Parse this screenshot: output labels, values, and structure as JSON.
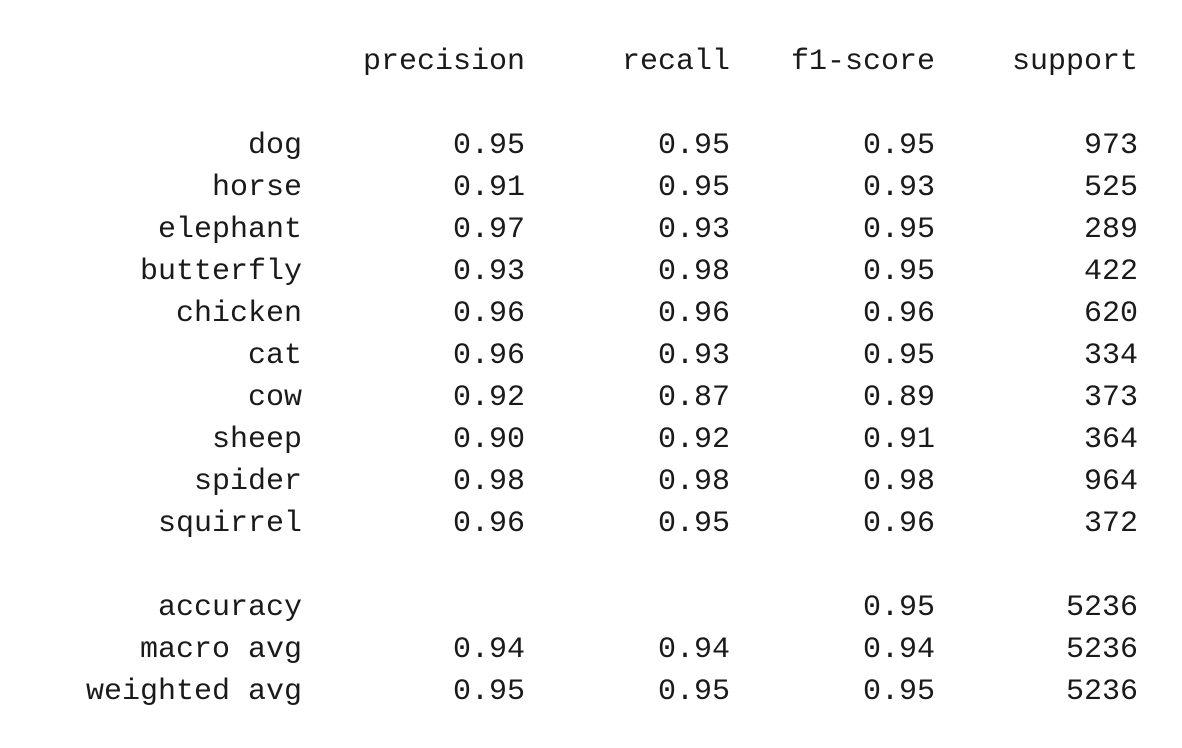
{
  "report": {
    "headers": {
      "precision": "precision",
      "recall": "recall",
      "f1": "f1-score",
      "support": "support"
    },
    "classes": [
      {
        "label": "dog",
        "precision": "0.95",
        "recall": "0.95",
        "f1": "0.95",
        "support": "973"
      },
      {
        "label": "horse",
        "precision": "0.91",
        "recall": "0.95",
        "f1": "0.93",
        "support": "525"
      },
      {
        "label": "elephant",
        "precision": "0.97",
        "recall": "0.93",
        "f1": "0.95",
        "support": "289"
      },
      {
        "label": "butterfly",
        "precision": "0.93",
        "recall": "0.98",
        "f1": "0.95",
        "support": "422"
      },
      {
        "label": "chicken",
        "precision": "0.96",
        "recall": "0.96",
        "f1": "0.96",
        "support": "620"
      },
      {
        "label": "cat",
        "precision": "0.96",
        "recall": "0.93",
        "f1": "0.95",
        "support": "334"
      },
      {
        "label": "cow",
        "precision": "0.92",
        "recall": "0.87",
        "f1": "0.89",
        "support": "373"
      },
      {
        "label": "sheep",
        "precision": "0.90",
        "recall": "0.92",
        "f1": "0.91",
        "support": "364"
      },
      {
        "label": "spider",
        "precision": "0.98",
        "recall": "0.98",
        "f1": "0.98",
        "support": "964"
      },
      {
        "label": "squirrel",
        "precision": "0.96",
        "recall": "0.95",
        "f1": "0.96",
        "support": "372"
      }
    ],
    "summary": [
      {
        "label": "accuracy",
        "precision": "",
        "recall": "",
        "f1": "0.95",
        "support": "5236"
      },
      {
        "label": "macro avg",
        "precision": "0.94",
        "recall": "0.94",
        "f1": "0.94",
        "support": "5236"
      },
      {
        "label": "weighted avg",
        "precision": "0.95",
        "recall": "0.95",
        "f1": "0.95",
        "support": "5236"
      }
    ]
  }
}
